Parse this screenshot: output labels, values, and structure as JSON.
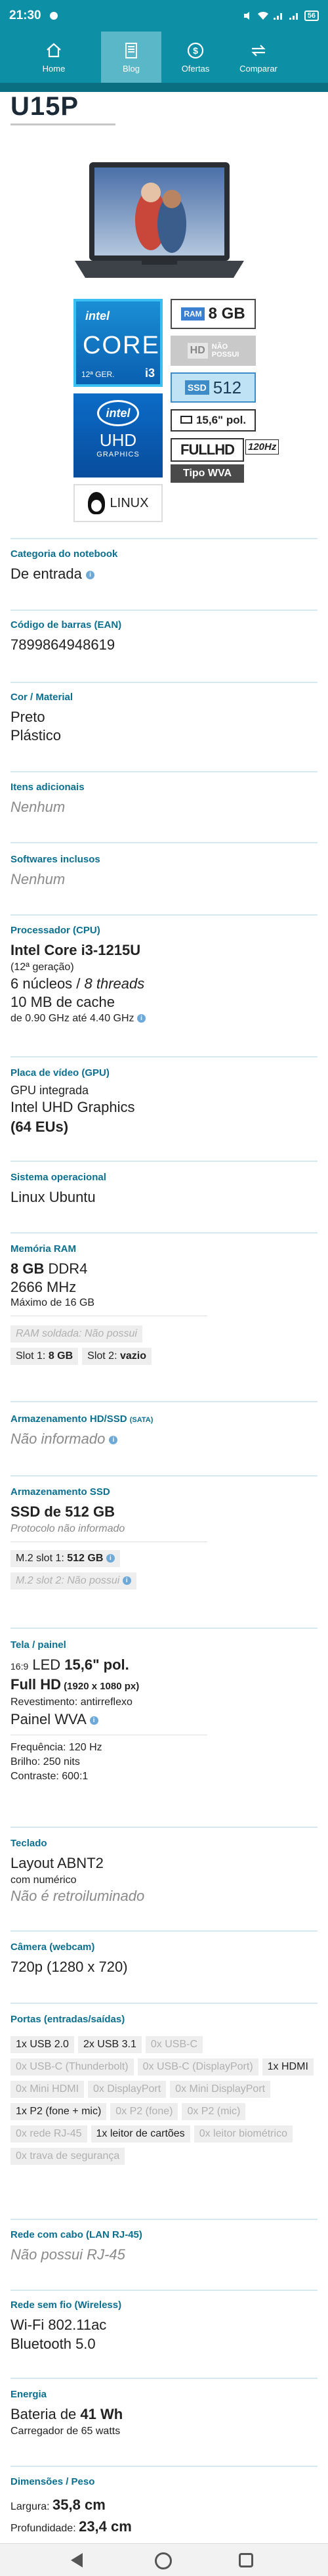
{
  "status_bar": {
    "time": "21:30",
    "battery": "56"
  },
  "nav": [
    {
      "label": "Home",
      "icon": "home-icon"
    },
    {
      "label": "Blog",
      "icon": "document-icon"
    },
    {
      "label": "Ofertas",
      "icon": "dollar-icon"
    },
    {
      "label": "Comparar",
      "icon": "compare-icon"
    }
  ],
  "model": "U15P",
  "badges": {
    "intel": "intel",
    "core": "CORE",
    "gen": "12ª GER.",
    "cpu_tier": "i3",
    "uhd_logo": "intel",
    "uhd": "UHD",
    "graphics": "GRAPHICS",
    "linux": "LINUX",
    "ram_tag": "RAM",
    "ram_value": "8 GB",
    "hd_tag": "HD",
    "hd_value_1": "NÃO",
    "hd_value_2": "POSSUI",
    "ssd_tag": "SSD",
    "ssd_value": "512",
    "screen_value": "15,6\" pol.",
    "fhd": "FULLHD",
    "hz": "120Hz",
    "wva": "Tipo WVA"
  },
  "specs": {
    "categoria": {
      "title": "Categoria do notebook",
      "value": "De entrada"
    },
    "ean": {
      "title": "Código de barras (EAN)",
      "value": "7899864948619"
    },
    "cor": {
      "title": "Cor / Material",
      "line1": "Preto",
      "line2": "Plástico"
    },
    "itens": {
      "title": "Itens adicionais",
      "value": "Nenhum"
    },
    "softwares": {
      "title": "Softwares inclusos",
      "value": "Nenhum"
    },
    "cpu": {
      "title": "Processador (CPU)",
      "name": "Intel Core i3-1215U",
      "gen": "(12ª geração)",
      "cores_a": "6 núcleos / ",
      "cores_b": "8 threads",
      "cache": "10 MB de cache",
      "clock": "de 0.90 GHz até 4.40 GHz"
    },
    "gpu": {
      "title": "Placa de vídeo (GPU)",
      "type": "GPU integrada",
      "name": "Intel UHD Graphics",
      "eus": "(64 EUs)"
    },
    "os": {
      "title": "Sistema operacional",
      "value": "Linux Ubuntu"
    },
    "ram": {
      "title": "Memória RAM",
      "size": "8 GB",
      "type": " DDR4",
      "freq": "2666 MHz",
      "max": "Máximo de 16 GB",
      "soldada": "RAM soldada: Não possui",
      "slot1_label": "Slot 1: ",
      "slot1_value": "8 GB",
      "slot2_label": "Slot 2: ",
      "slot2_value": "vazio"
    },
    "hd": {
      "title": "Armazenamento HD/SSD",
      "title_suffix": "(SATA)",
      "value": "Não informado"
    },
    "ssd": {
      "title": "Armazenamento SSD",
      "value": "SSD de 512 GB",
      "protocol": "Protocolo não informado",
      "m2_1_label": "M.2 slot 1: ",
      "m2_1_value": "512 GB",
      "m2_2": "M.2 slot 2: Não possui"
    },
    "tela": {
      "title": "Tela / painel",
      "ratio": "16:9",
      "led_a": " LED ",
      "size": "15,6\" pol.",
      "res": "Full HD",
      "res_px": " (1920 x 1080 px)",
      "revest": "Revestimento: antirreflexo",
      "painel": "Painel WVA",
      "freq": "Frequência: 120 Hz",
      "brilho": "Brilho: 250 nits",
      "contraste": "Contraste: 600:1"
    },
    "teclado": {
      "title": "Teclado",
      "layout": "Layout ABNT2",
      "num": "com numérico",
      "retro": "Não é retroiluminado"
    },
    "camera": {
      "title": "Câmera (webcam)",
      "value": "720p (1280 x 720)"
    },
    "portas": {
      "title": "Portas (entradas/saídas)",
      "chips": [
        {
          "label": "1x USB 2.0",
          "on": true
        },
        {
          "label": "2x USB 3.1",
          "on": true
        },
        {
          "label": "0x USB-C",
          "on": false
        },
        {
          "label": "0x USB-C (Thunderbolt)",
          "on": false
        },
        {
          "label": "0x USB-C (DisplayPort)",
          "on": false
        },
        {
          "label": "1x HDMI",
          "on": true
        },
        {
          "label": "0x Mini HDMI",
          "on": false
        },
        {
          "label": "0x DisplayPort",
          "on": false
        },
        {
          "label": "0x Mini DisplayPort",
          "on": false
        },
        {
          "label": "1x P2 (fone + mic)",
          "on": true
        },
        {
          "label": "0x P2 (fone)",
          "on": false
        },
        {
          "label": "0x P2 (mic)",
          "on": false
        },
        {
          "label": "0x rede RJ-45",
          "on": false
        },
        {
          "label": "1x leitor de cartões",
          "on": true
        },
        {
          "label": "0x leitor biométrico",
          "on": false
        },
        {
          "label": "0x trava de segurança",
          "on": false
        }
      ]
    },
    "lan": {
      "title": "Rede com cabo (LAN RJ-45)",
      "value": "Não possui RJ-45"
    },
    "wifi": {
      "title": "Rede sem fio (Wireless)",
      "wifi": "Wi-Fi 802.11ac",
      "bt": "Bluetooth 5.0"
    },
    "energia": {
      "title": "Energia",
      "bat_a": "Bateria de ",
      "bat_b": "41 Wh",
      "charger": "Carregador de 65 watts"
    },
    "dim": {
      "title": "Dimensões / Peso",
      "largura_label": "Largura: ",
      "largura": "35,8 cm",
      "prof_label": "Profundidade: ",
      "prof": "23,4 cm"
    }
  },
  "colors": {
    "accent": "#0d8fa6",
    "title": "#0b6f8f"
  }
}
